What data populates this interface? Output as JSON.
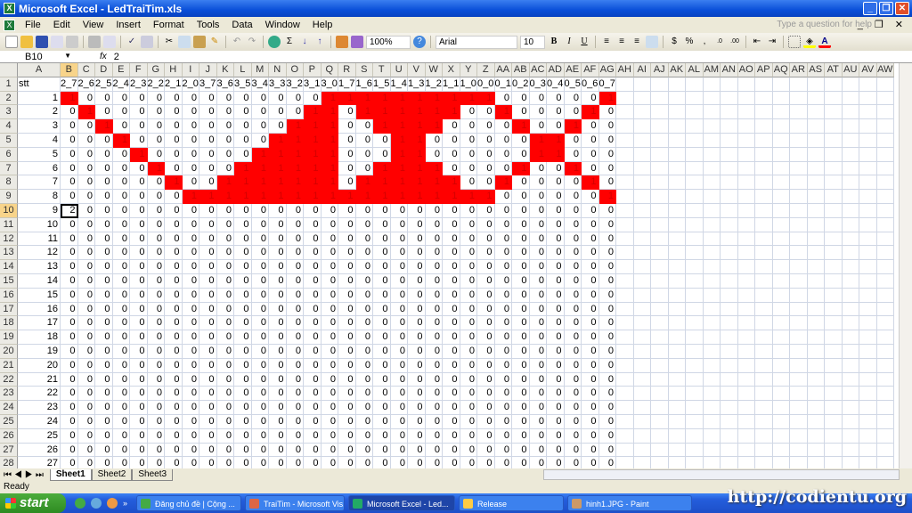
{
  "window": {
    "title": "Microsoft Excel - LedTraiTim.xls"
  },
  "menu": [
    "File",
    "Edit",
    "View",
    "Insert",
    "Format",
    "Tools",
    "Data",
    "Window",
    "Help"
  ],
  "help_placeholder": "Type a question for help",
  "toolbar": {
    "zoom": "100%",
    "font": "Arial",
    "font_size": "10",
    "sum": "Σ",
    "bold": "B",
    "italic": "I",
    "underline": "U",
    "currency": "$",
    "percent": "%",
    "comma": ","
  },
  "formula": {
    "name_box": "B10",
    "fx": "fx",
    "value": "2"
  },
  "columns": [
    "A",
    "B",
    "C",
    "D",
    "E",
    "F",
    "G",
    "H",
    "I",
    "J",
    "K",
    "L",
    "M",
    "N",
    "O",
    "P",
    "Q",
    "R",
    "S",
    "T",
    "U",
    "V",
    "W",
    "X",
    "Y",
    "Z",
    "AA",
    "AB",
    "AC",
    "AD",
    "AE",
    "AF",
    "AG",
    "AH",
    "AI",
    "AJ",
    "AK",
    "AL",
    "AM",
    "AN",
    "AO",
    "AP",
    "AQ",
    "AR",
    "AS",
    "AT",
    "AU",
    "AV",
    "AW"
  ],
  "header_row": {
    "a": "stt",
    "labels": [
      "2_7",
      "2_6",
      "2_5",
      "2_4",
      "2_3",
      "2_2",
      "2_1",
      "2_0",
      "3_7",
      "3_6",
      "3_5",
      "3_4",
      "3_3",
      "3_2",
      "3_1",
      "3_0",
      "1_7",
      "1_6",
      "1_5",
      "1_4",
      "1_3",
      "1_2",
      "1_1",
      "1_0",
      "0_0",
      "0_1",
      "0_2",
      "0_3",
      "0_4",
      "0_5",
      "0_6",
      "0_7"
    ]
  },
  "data_rows": [
    {
      "stt": "1",
      "bits": "10000000000000011111111110000001"
    },
    {
      "stt": "2",
      "bits": "01000000000000110111111001000010"
    },
    {
      "stt": "3",
      "bits": "00100000000001110011110000100100"
    },
    {
      "stt": "4",
      "bits": "00010000000011110001100000011000"
    },
    {
      "stt": "5",
      "bits": "00001000000111110001100000011000"
    },
    {
      "stt": "6",
      "bits": "00000100001111110011110000100100"
    },
    {
      "stt": "7",
      "bits": "00000010011111110111111001000010"
    },
    {
      "stt": "8",
      "bits": "00000001111111111111111110000001"
    },
    {
      "stt": "9",
      "bits": "20000000000000000000000000000000"
    },
    {
      "stt": "10",
      "bits": "00000000000000000000000000000000"
    },
    {
      "stt": "11",
      "bits": "00000000000000000000000000000000"
    },
    {
      "stt": "12",
      "bits": "00000000000000000000000000000000"
    },
    {
      "stt": "13",
      "bits": "00000000000000000000000000000000"
    },
    {
      "stt": "14",
      "bits": "00000000000000000000000000000000"
    },
    {
      "stt": "15",
      "bits": "00000000000000000000000000000000"
    },
    {
      "stt": "16",
      "bits": "00000000000000000000000000000000"
    },
    {
      "stt": "17",
      "bits": "00000000000000000000000000000000"
    },
    {
      "stt": "18",
      "bits": "00000000000000000000000000000000"
    },
    {
      "stt": "19",
      "bits": "00000000000000000000000000000000"
    },
    {
      "stt": "20",
      "bits": "00000000000000000000000000000000"
    },
    {
      "stt": "21",
      "bits": "00000000000000000000000000000000"
    },
    {
      "stt": "22",
      "bits": "00000000000000000000000000000000"
    },
    {
      "stt": "23",
      "bits": "00000000000000000000000000000000"
    },
    {
      "stt": "24",
      "bits": "00000000000000000000000000000000"
    },
    {
      "stt": "25",
      "bits": "00000000000000000000000000000000"
    },
    {
      "stt": "26",
      "bits": "00000000000000000000000000000000"
    },
    {
      "stt": "27",
      "bits": "00000000000000000000000000000000"
    }
  ],
  "sheets": [
    "Sheet1",
    "Sheet2",
    "Sheet3"
  ],
  "status": "Ready",
  "taskbar": {
    "start": "start",
    "items": [
      "Đăng chủ đề | Cộng ...",
      "TraiTim - Microsoft Vis...",
      "Microsoft Excel - Led...",
      "Release",
      "hinh1.JPG - Paint"
    ]
  },
  "watermark": "http://codientu.org",
  "colors": {
    "led_on": "#ff0000",
    "titlebar": "#0a4fd8"
  }
}
